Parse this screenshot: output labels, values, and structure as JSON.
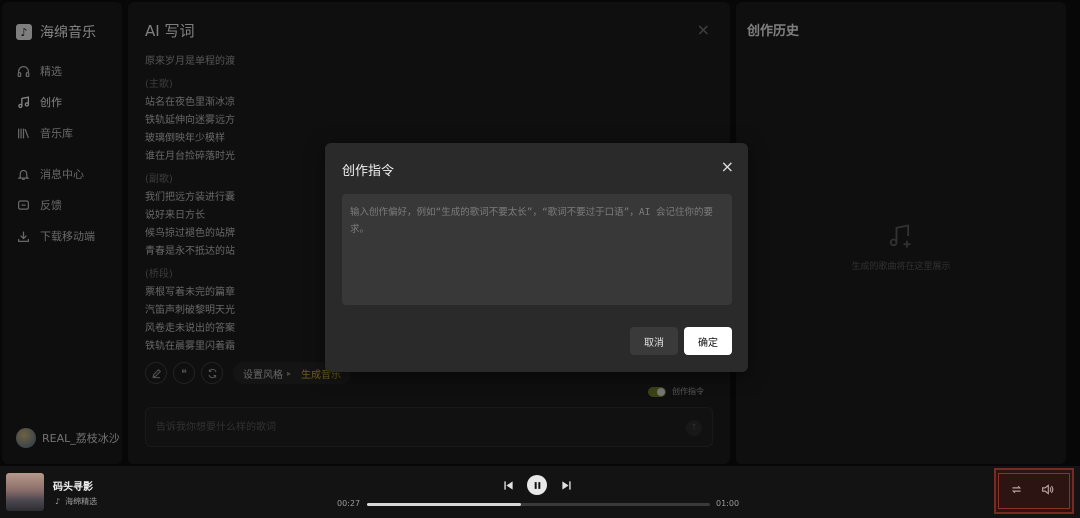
{
  "brand": {
    "name": "海绵音乐"
  },
  "sidebar": {
    "items": [
      {
        "label": "精选",
        "icon": "headphones-icon"
      },
      {
        "label": "创作",
        "icon": "music-note-icon"
      },
      {
        "label": "音乐库",
        "icon": "library-icon"
      },
      {
        "label": "消息中心",
        "icon": "bell-icon"
      },
      {
        "label": "反馈",
        "icon": "feedback-icon"
      },
      {
        "label": "下载移动端",
        "icon": "download-icon"
      }
    ],
    "user": {
      "name": "REAL_荔枝冰沙"
    }
  },
  "main": {
    "title": "AI 写词",
    "close_glyph": "×",
    "lyrics": [
      {
        "kind": "line",
        "text": "原来岁月是单程的渡"
      },
      {
        "kind": "section",
        "text": "(主歌)"
      },
      {
        "kind": "line",
        "text": "站名在夜色里渐冰凉"
      },
      {
        "kind": "line",
        "text": "铁轨延伸向迷雾远方"
      },
      {
        "kind": "line",
        "text": "玻璃倒映年少模样"
      },
      {
        "kind": "line",
        "text": "谁在月台捡碎落时光"
      },
      {
        "kind": "section",
        "text": "(副歌)"
      },
      {
        "kind": "line",
        "text": "我们把远方装进行囊"
      },
      {
        "kind": "line",
        "text": "说好来日方长"
      },
      {
        "kind": "line",
        "text": "候鸟掠过褪色的站牌"
      },
      {
        "kind": "line",
        "text": "青春是永不抵达的站"
      },
      {
        "kind": "section",
        "text": "(桥段)"
      },
      {
        "kind": "line",
        "text": "票根写着未完的篇章"
      },
      {
        "kind": "line",
        "text": "汽笛声刺破黎明天光"
      },
      {
        "kind": "line",
        "text": "风卷走未说出的答案"
      },
      {
        "kind": "line",
        "text": "铁轨在晨雾里闪着霜"
      }
    ],
    "toolbar": {
      "style_label": "设置风格",
      "style_arrow": "▸",
      "generate_label": "生成音乐"
    },
    "command_toggle": {
      "label": "创作指令",
      "enabled": true
    },
    "prompt": {
      "placeholder": "告诉我你想要什么样的歌词"
    }
  },
  "history": {
    "title": "创作历史",
    "empty_text": "生成的歌曲将在这里展示"
  },
  "modal": {
    "title": "创作指令",
    "close_glyph": "×",
    "textarea_placeholder": "输入创作偏好，例如“生成的歌词不要太长”，“歌词不要过于口语”，AI 会记住你的要求。",
    "cancel_label": "取消",
    "ok_label": "确定"
  },
  "player": {
    "song_title": "码头寻影",
    "song_source": "海绵精选",
    "current_time": "00:27",
    "total_time": "01:00",
    "progress_fraction": 0.45
  },
  "colors": {
    "accent_generate": "#c9ae31",
    "toggle_on": "#6a7a28",
    "stamp": "#7a2a22"
  }
}
